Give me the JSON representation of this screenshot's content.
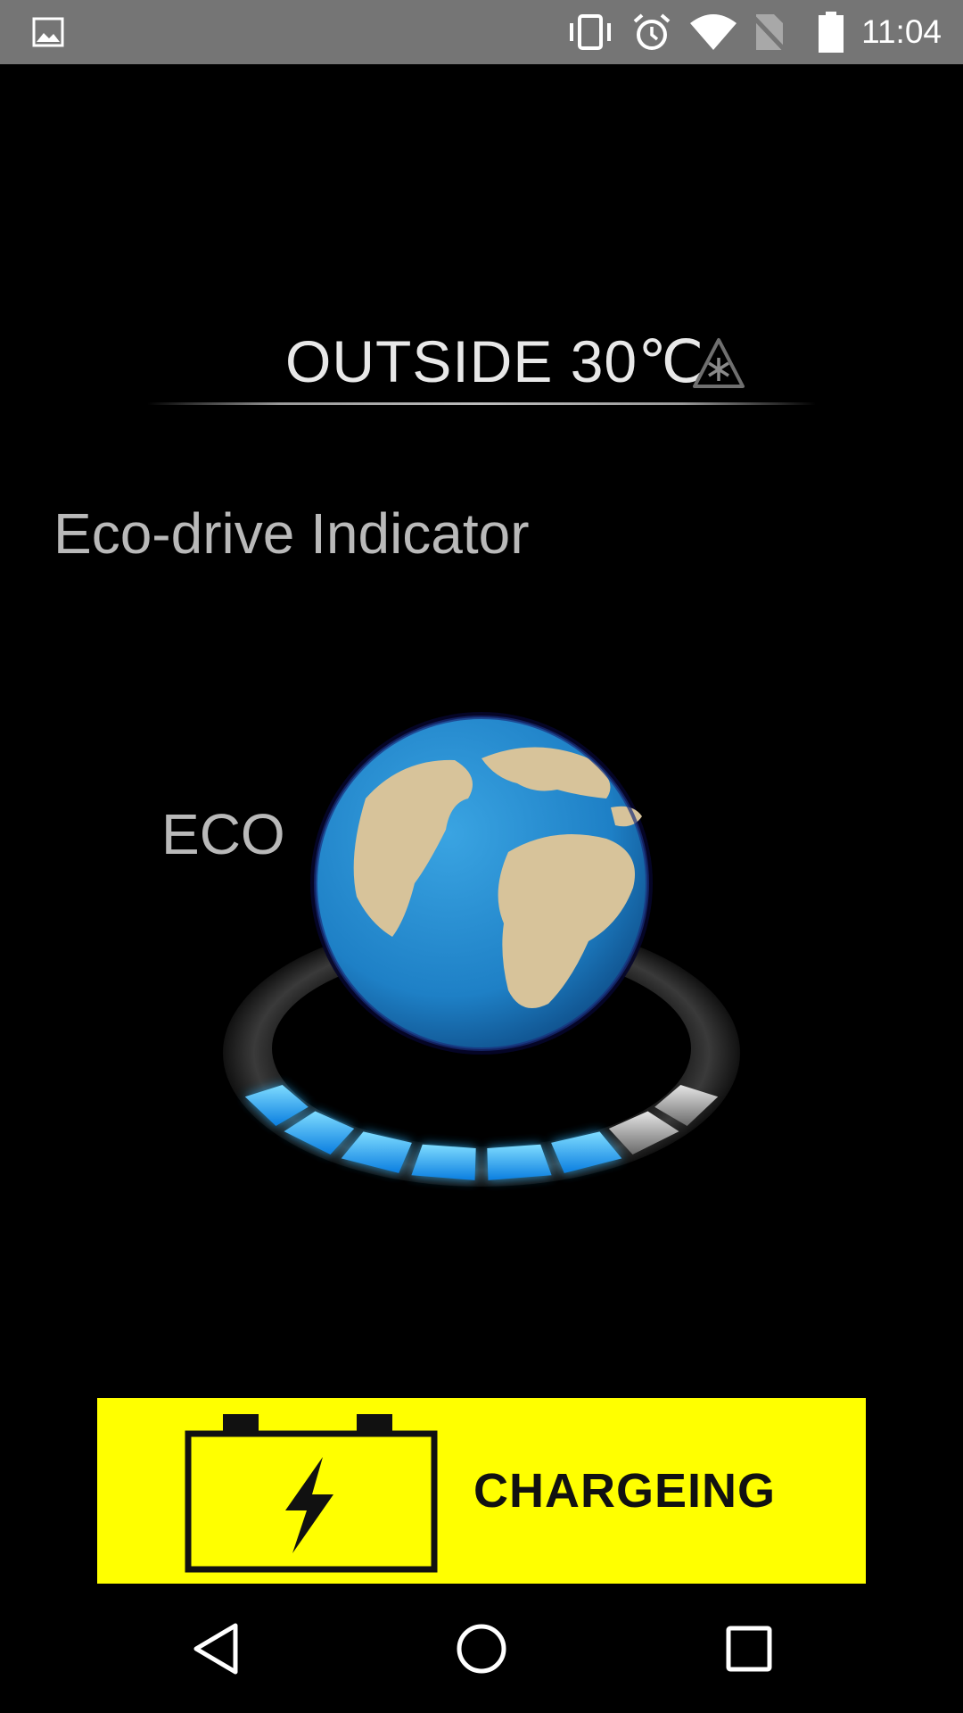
{
  "status_bar": {
    "time": "11:04",
    "left_icon": "gallery-icon",
    "icons": [
      "vibrate-icon",
      "alarm-icon",
      "wifi-icon",
      "no-sim-icon",
      "battery-icon"
    ]
  },
  "header": {
    "outside_label": "OUTSIDE 30℃",
    "warning_icon": "ice-warning-icon"
  },
  "main": {
    "title": "Eco-drive Indicator",
    "mode_label": "ECO",
    "gauge": {
      "segments_total": 8,
      "segments_lit": 6,
      "accent_color": "#27a9f0"
    }
  },
  "banner": {
    "label": "CHARGEING",
    "icon": "battery-charging-icon",
    "color": "#ffff00"
  },
  "nav_bar": {
    "items": [
      "back-icon",
      "home-icon",
      "recents-icon"
    ]
  }
}
